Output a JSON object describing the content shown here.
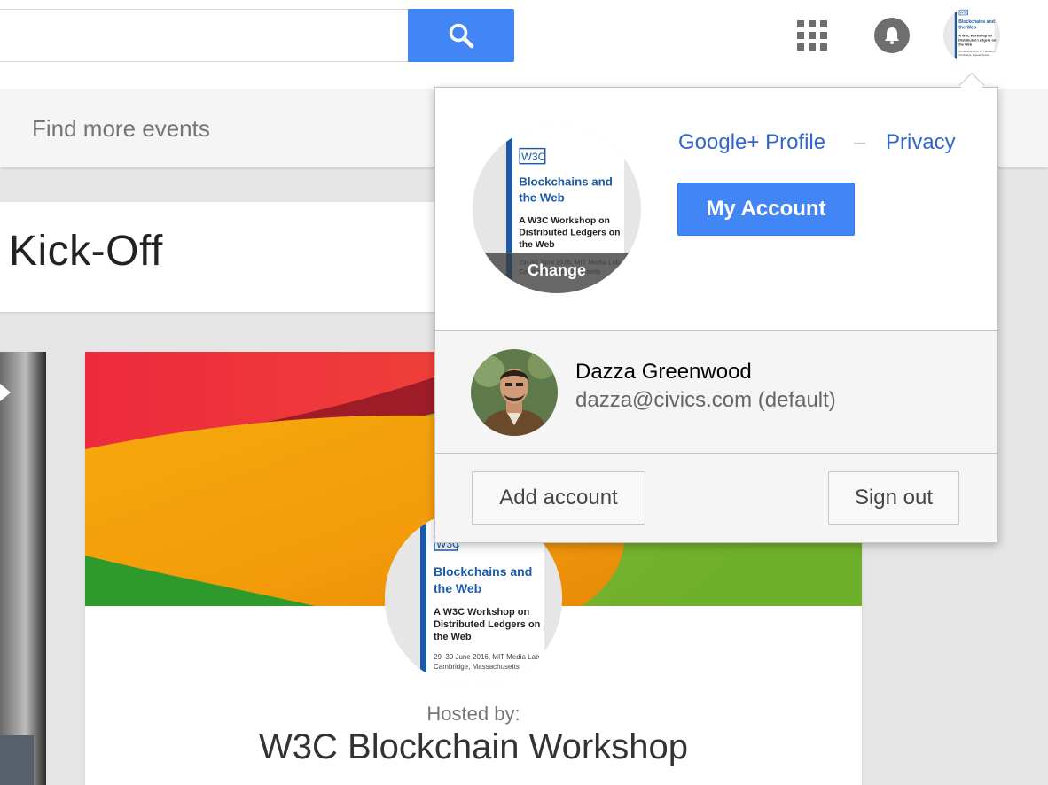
{
  "topbar": {
    "search": {
      "value": "",
      "placeholder": ""
    },
    "icons": {
      "search": "search-icon",
      "apps": "apps-grid-icon",
      "notifications": "bell-icon"
    }
  },
  "subnav": {
    "find_more_events": "Find more events"
  },
  "event": {
    "title": "Kick-Off",
    "hosted_by_label": "Hosted by:",
    "host_name": "W3C Blockchain Workshop"
  },
  "poster": {
    "logo": "W3C",
    "title_line1": "Blockchains and",
    "title_line2": "the Web",
    "subtitle_line1": "A W3C Workshop on",
    "subtitle_line2": "Distributed Ledgers on",
    "subtitle_line3": "the Web",
    "date_line1": "29–30 June 2016, MIT Media Lab,",
    "date_line2": "Cambridge, Massachusetts"
  },
  "account_popup": {
    "change_label": "Change",
    "profile_link": "Google+ Profile",
    "separator": "–",
    "privacy_link": "Privacy",
    "my_account_button": "My Account",
    "user": {
      "name": "Dazza Greenwood",
      "email": "dazza@civics.com (default)"
    },
    "add_account_button": "Add account",
    "sign_out_button": "Sign out"
  },
  "colors": {
    "accent_blue": "#4285f4",
    "link_blue": "#3366cc",
    "poster_blue": "#1a5aa6"
  }
}
